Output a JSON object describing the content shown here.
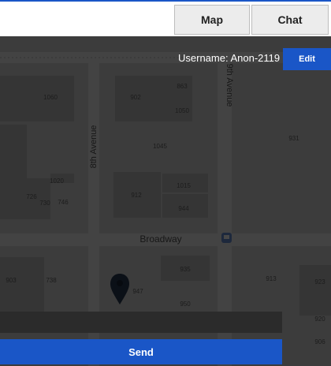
{
  "header": {
    "tabs": [
      {
        "label": "Map"
      },
      {
        "label": "Chat"
      }
    ]
  },
  "map": {
    "streets": [
      "8th Avenue",
      "9th Avenue",
      "Broadway"
    ],
    "building_numbers": [
      "863",
      "902",
      "1060",
      "1050",
      "1045",
      "931",
      "1020",
      "1015",
      "912",
      "746",
      "730",
      "726",
      "944",
      "935",
      "903",
      "738",
      "947",
      "913",
      "950",
      "920",
      "906",
      "923",
      "915"
    ],
    "pin_icon": "map-pin-icon",
    "transit_icon": "transit-stop-icon"
  },
  "user": {
    "label": "Username: Anon-2119",
    "edit_label": "Edit"
  },
  "composer": {
    "placeholder": "",
    "send_label": "Send"
  },
  "colors": {
    "accent": "#1a56c7",
    "input_bg": "#2b2b2b"
  }
}
